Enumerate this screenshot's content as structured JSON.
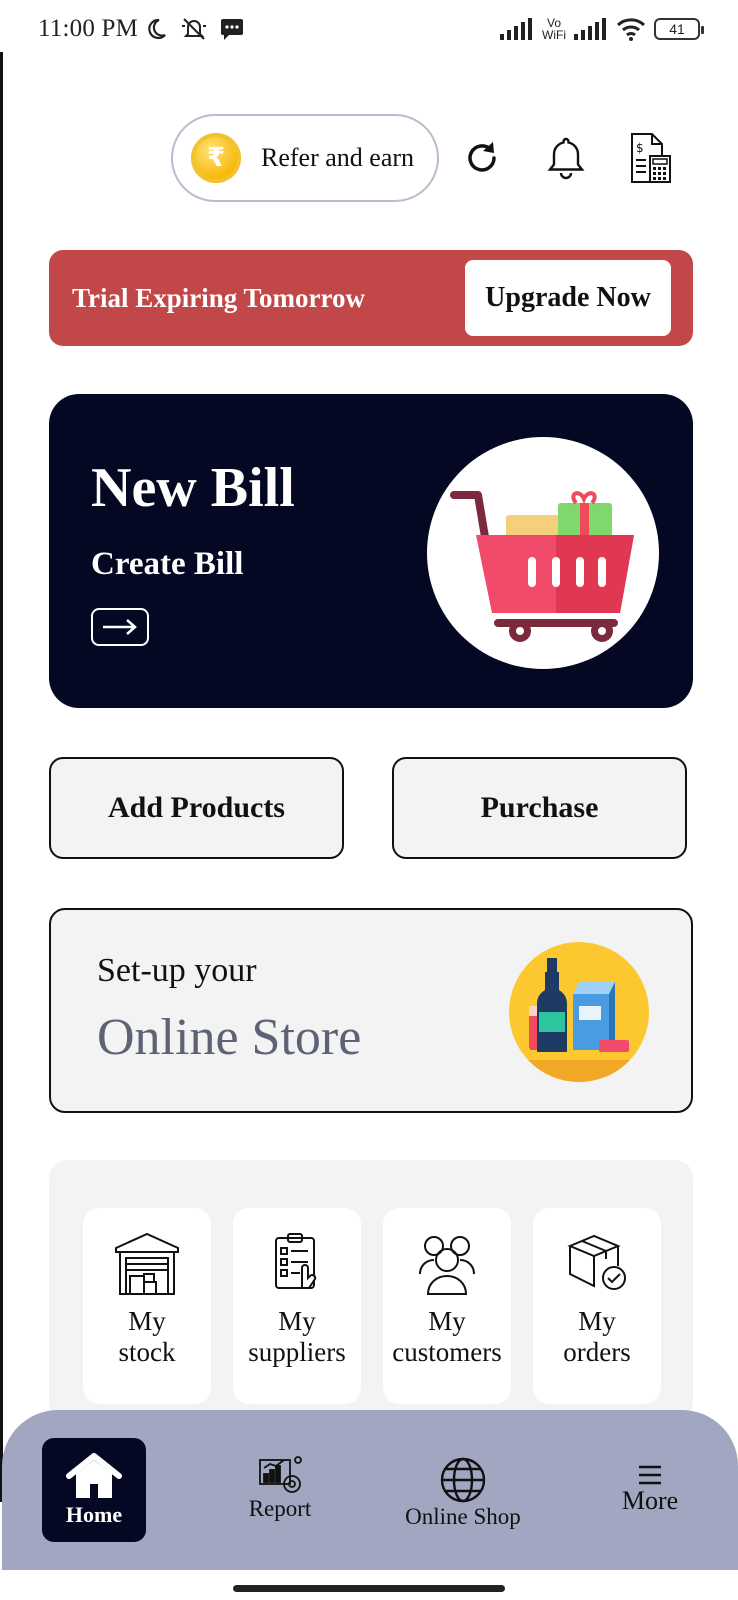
{
  "status_bar": {
    "time": "11:00 PM",
    "vowifi_top": "Vo",
    "vowifi_bottom": "WiFi",
    "battery": "41"
  },
  "header": {
    "refer_label": "Refer and earn",
    "coin_symbol": "₹"
  },
  "trial_banner": {
    "text": "Trial Expiring Tomorrow",
    "button_label": "Upgrade Now"
  },
  "new_bill": {
    "title": "New Bill",
    "subtitle": "Create Bill"
  },
  "actions": {
    "add_products": "Add Products",
    "purchase": "Purchase"
  },
  "online_store": {
    "pre": "Set-up your",
    "title": "Online Store"
  },
  "tiles": [
    {
      "label_1": "My",
      "label_2": "stock"
    },
    {
      "label_1": "My",
      "label_2": "suppliers"
    },
    {
      "label_1": "My",
      "label_2": "customers"
    },
    {
      "label_1": "My",
      "label_2": "orders"
    }
  ],
  "bottom_nav": {
    "home": "Home",
    "report": "Report",
    "online_shop": "Online Shop",
    "more": "More"
  },
  "colors": {
    "banner": "#c14749",
    "card_dark": "#040822",
    "nav_bg": "#a2a7c1",
    "store_title": "#5d6275"
  }
}
